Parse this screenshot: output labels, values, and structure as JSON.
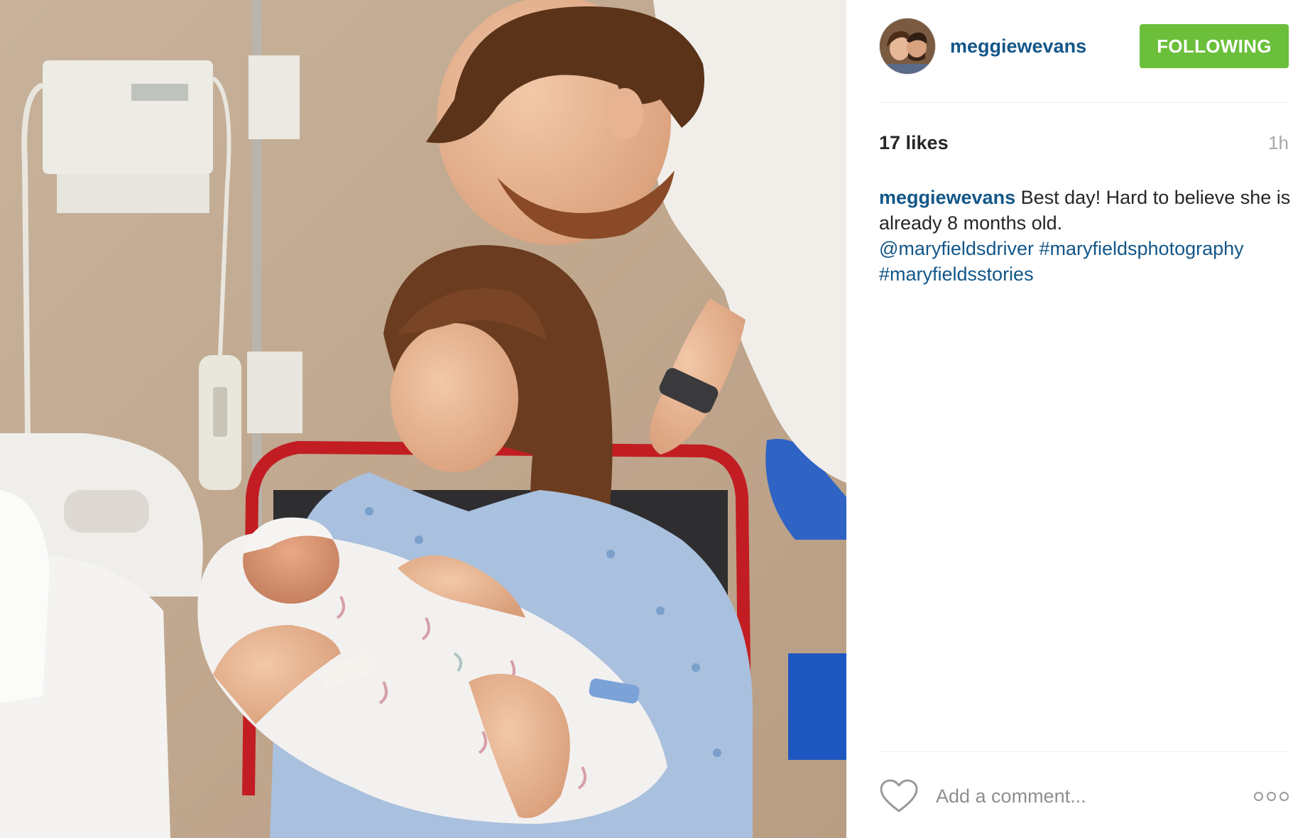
{
  "post": {
    "image_alt": "Parents with their newborn baby in a hospital room",
    "author": {
      "username": "meggiewevans",
      "avatar_alt": "meggiewevans profile picture"
    },
    "follow_button": "FOLLOWING",
    "likes": "17 likes",
    "time_ago": "1h",
    "caption": {
      "username": "meggiewevans",
      "text": "Best day! Hard to believe she is already 8 months old.",
      "mentions": [
        "@maryfieldsdriver",
        "#maryfieldsphotography",
        "#maryfieldsstories"
      ]
    },
    "comment_placeholder": "Add a comment...",
    "icons": {
      "like": "heart-outline-icon",
      "more": "more-options-icon"
    },
    "colors": {
      "username": "#125688",
      "follow_button": "#6bbf3a",
      "time": "#a5a7aa"
    }
  }
}
